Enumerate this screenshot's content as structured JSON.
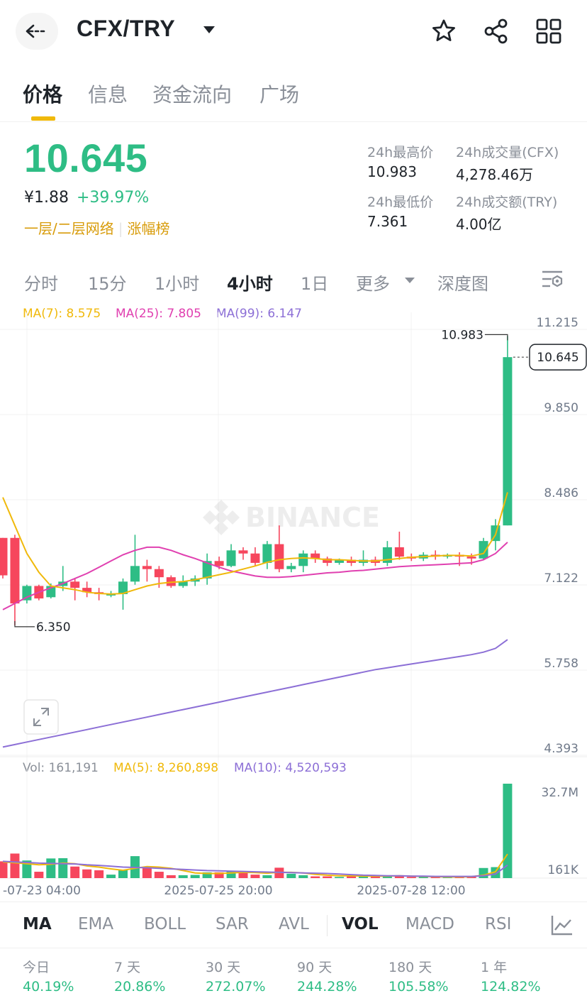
{
  "header": {
    "pair": "CFX/TRY"
  },
  "tabs": [
    "价格",
    "信息",
    "资金流向",
    "广场"
  ],
  "price": {
    "last": "10.645",
    "cny": "¥1.88",
    "change": "+39.97%"
  },
  "tags": [
    "一层/二层网络",
    "涨幅榜"
  ],
  "stats": {
    "high_label": "24h最高价",
    "high": "10.983",
    "vol_label": "24h成交量(CFX)",
    "vol": "4,278.46万",
    "low_label": "24h最低价",
    "low": "7.361",
    "amt_label": "24h成交额(TRY)",
    "amt": "4.00亿"
  },
  "intervals": [
    "分时",
    "15分",
    "1小时",
    "4小时",
    "1日",
    "更多",
    "深度图"
  ],
  "ma_legend": {
    "ma7": "MA(7): 8.575",
    "ma25": "MA(25): 7.805",
    "ma99": "MA(99): 6.147"
  },
  "vol_legend": {
    "vol": "Vol: 161,191",
    "ma5": "MA(5): 8,260,898",
    "ma10": "MA(10): 4,520,593"
  },
  "colors": {
    "up": "#2ebd85",
    "down": "#f6465d",
    "ma7": "#f0b90b",
    "ma25": "#e040b0",
    "ma99": "#8c6fd6",
    "accent": "#f0b90b"
  },
  "chart_data": {
    "type": "candlestick",
    "y_axis_ticks": [
      "11.215",
      "9.850",
      "8.486",
      "7.122",
      "5.758",
      "4.393"
    ],
    "ylim": [
      4.393,
      11.215
    ],
    "x_tick_labels": [
      "-07-23 04:00",
      "2025-07-25 20:00",
      "2025-07-28 12:00"
    ],
    "high_marker": "10.983",
    "low_marker": "6.350",
    "last_price_marker": "10.645",
    "ohlc": [
      [
        7.75,
        7.75,
        7.1,
        7.15
      ],
      [
        7.75,
        7.8,
        6.35,
        6.7
      ],
      [
        6.75,
        7.0,
        6.7,
        6.98
      ],
      [
        6.98,
        7.0,
        6.75,
        6.78
      ],
      [
        6.8,
        7.02,
        6.78,
        6.98
      ],
      [
        6.98,
        7.3,
        6.9,
        7.05
      ],
      [
        7.05,
        7.1,
        6.75,
        6.95
      ],
      [
        6.95,
        7.05,
        6.8,
        6.88
      ],
      [
        6.88,
        6.95,
        6.75,
        6.85
      ],
      [
        6.85,
        6.9,
        6.8,
        6.85
      ],
      [
        6.85,
        7.1,
        6.6,
        7.05
      ],
      [
        7.05,
        7.8,
        7.0,
        7.3
      ],
      [
        7.3,
        7.4,
        7.05,
        7.25
      ],
      [
        7.25,
        7.3,
        6.95,
        7.12
      ],
      [
        7.12,
        7.15,
        6.95,
        6.98
      ],
      [
        6.98,
        7.15,
        6.95,
        7.05
      ],
      [
        7.05,
        7.15,
        6.98,
        7.1
      ],
      [
        7.1,
        7.5,
        7.0,
        7.38
      ],
      [
        7.38,
        7.45,
        7.25,
        7.3
      ],
      [
        7.3,
        7.65,
        7.28,
        7.55
      ],
      [
        7.55,
        7.6,
        7.4,
        7.5
      ],
      [
        7.5,
        7.6,
        7.3,
        7.35
      ],
      [
        7.35,
        7.7,
        7.25,
        7.65
      ],
      [
        7.65,
        7.95,
        7.2,
        7.25
      ],
      [
        7.25,
        7.35,
        7.2,
        7.3
      ],
      [
        7.3,
        7.55,
        7.2,
        7.5
      ],
      [
        7.5,
        7.55,
        7.35,
        7.42
      ],
      [
        7.42,
        7.45,
        7.3,
        7.35
      ],
      [
        7.35,
        7.42,
        7.32,
        7.4
      ],
      [
        7.4,
        7.45,
        7.3,
        7.35
      ],
      [
        7.35,
        7.55,
        7.3,
        7.4
      ],
      [
        7.4,
        7.45,
        7.3,
        7.35
      ],
      [
        7.35,
        7.7,
        7.3,
        7.6
      ],
      [
        7.6,
        7.85,
        7.4,
        7.45
      ],
      [
        7.45,
        7.5,
        7.38,
        7.42
      ],
      [
        7.42,
        7.52,
        7.38,
        7.48
      ],
      [
        7.48,
        7.55,
        7.4,
        7.45
      ],
      [
        7.45,
        7.5,
        7.42,
        7.48
      ],
      [
        7.48,
        7.52,
        7.3,
        7.45
      ],
      [
        7.45,
        7.5,
        7.32,
        7.42
      ],
      [
        7.42,
        7.75,
        7.4,
        7.7
      ],
      [
        7.7,
        8.05,
        7.55,
        7.95
      ],
      [
        7.95,
        10.983,
        7.95,
        10.645
      ]
    ],
    "ma7": [
      8.4,
      7.95,
      7.5,
      7.2,
      6.98,
      6.95,
      6.92,
      6.88,
      6.86,
      6.85,
      6.86,
      6.92,
      6.98,
      7.02,
      7.04,
      7.05,
      7.08,
      7.12,
      7.16,
      7.2,
      7.25,
      7.3,
      7.36,
      7.4,
      7.42,
      7.43,
      7.42,
      7.4,
      7.4,
      7.39,
      7.38,
      7.38,
      7.4,
      7.42,
      7.44,
      7.45,
      7.46,
      7.47,
      7.47,
      7.46,
      7.5,
      7.8,
      8.48
    ],
    "ma25": [
      6.6,
      6.7,
      6.8,
      6.88,
      6.95,
      7.02,
      7.1,
      7.18,
      7.28,
      7.38,
      7.48,
      7.55,
      7.6,
      7.6,
      7.55,
      7.48,
      7.42,
      7.35,
      7.28,
      7.22,
      7.18,
      7.14,
      7.12,
      7.12,
      7.13,
      7.15,
      7.17,
      7.19,
      7.2,
      7.22,
      7.23,
      7.25,
      7.27,
      7.29,
      7.3,
      7.31,
      7.32,
      7.33,
      7.34,
      7.35,
      7.4,
      7.5,
      7.68
    ],
    "ma99": [
      4.4,
      4.44,
      4.48,
      4.52,
      4.56,
      4.6,
      4.64,
      4.68,
      4.72,
      4.76,
      4.8,
      4.84,
      4.88,
      4.92,
      4.96,
      5.0,
      5.04,
      5.08,
      5.12,
      5.16,
      5.2,
      5.24,
      5.28,
      5.32,
      5.36,
      5.4,
      5.44,
      5.48,
      5.52,
      5.56,
      5.6,
      5.64,
      5.67,
      5.7,
      5.73,
      5.76,
      5.79,
      5.82,
      5.85,
      5.88,
      5.92,
      5.98,
      6.12
    ],
    "volume_ticks": [
      "32.7M",
      "161K"
    ],
    "volume_max": 32.7,
    "volume_m": [
      5.8,
      8.5,
      6.1,
      2.2,
      6.8,
      6.9,
      4.0,
      3.0,
      2.7,
      1.2,
      2.8,
      7.6,
      3.8,
      2.2,
      1.0,
      1.0,
      1.1,
      2.0,
      2.0,
      2.4,
      2.0,
      1.2,
      1.0,
      3.6,
      1.5,
      1.0,
      0.6,
      0.6,
      0.4,
      0.9,
      0.6,
      0.6,
      1.0,
      1.0,
      0.4,
      0.4,
      0.4,
      0.3,
      0.4,
      0.5,
      3.5,
      3.8,
      32.7
    ],
    "vol_ma5": [
      5.6,
      5.3,
      5.0,
      4.6,
      4.8,
      5.2,
      5.0,
      4.2,
      3.8,
      3.2,
      2.7,
      3.4,
      4.0,
      3.8,
      3.4,
      2.6,
      1.8,
      1.6,
      1.6,
      1.8,
      2.0,
      1.9,
      1.7,
      2.0,
      2.0,
      1.8,
      1.3,
      1.0,
      0.8,
      0.8,
      0.7,
      0.7,
      0.7,
      0.8,
      0.7,
      0.6,
      0.5,
      0.4,
      0.4,
      0.5,
      1.0,
      2.2,
      8.3
    ],
    "vol_ma10": [
      5.8,
      5.6,
      5.4,
      5.2,
      5.1,
      5.0,
      4.9,
      4.6,
      4.4,
      4.1,
      3.8,
      3.7,
      3.6,
      3.4,
      3.2,
      3.0,
      2.8,
      2.6,
      2.5,
      2.4,
      2.3,
      2.2,
      2.1,
      2.0,
      1.9,
      1.8,
      1.7,
      1.6,
      1.4,
      1.2,
      1.0,
      0.9,
      0.8,
      0.8,
      0.7,
      0.7,
      0.6,
      0.6,
      0.6,
      0.6,
      0.8,
      1.4,
      4.5
    ]
  },
  "indicators": [
    "MA",
    "EMA",
    "BOLL",
    "SAR",
    "AVL",
    "VOL",
    "MACD",
    "RSI"
  ],
  "performance": [
    {
      "label": "今日",
      "value": "40.19%"
    },
    {
      "label": "7 天",
      "value": "20.86%"
    },
    {
      "label": "30 天",
      "value": "272.07%"
    },
    {
      "label": "90 天",
      "value": "244.28%"
    },
    {
      "label": "180 天",
      "value": "105.58%"
    },
    {
      "label": "1 年",
      "value": "124.82%"
    }
  ]
}
